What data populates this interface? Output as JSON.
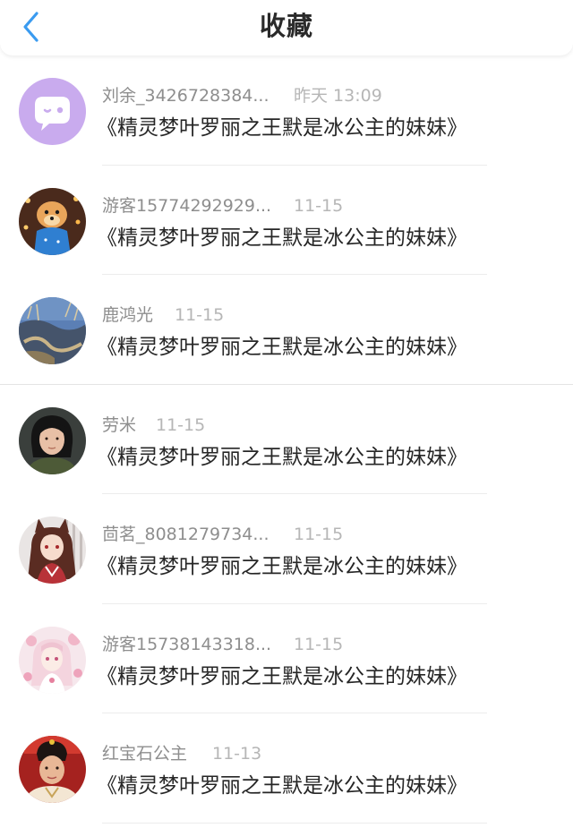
{
  "header": {
    "title": "收藏",
    "back_icon": "chevron-left-icon",
    "accent": "#3a9bf0"
  },
  "items": [
    {
      "user": "刘余_3426728384...",
      "time": "昨天 13:09",
      "title": "《精灵梦叶罗丽之王默是冰公主的妹妹》",
      "avatar": "chat-bubble-avatar"
    },
    {
      "user": "游客15774292929...",
      "time": "11-15",
      "title": "《精灵梦叶罗丽之王默是冰公主的妹妹》",
      "avatar": "puppy-photo-avatar"
    },
    {
      "user": "鹿鸿光",
      "time": "11-15",
      "title": "《精灵梦叶罗丽之王默是冰公主的妹妹》",
      "avatar": "landscape-photo-avatar"
    },
    {
      "user": "劳米",
      "time": "11-15",
      "title": "《精灵梦叶罗丽之王默是冰公主的妹妹》",
      "avatar": "selfie-photo-avatar"
    },
    {
      "user": "茴茗_8081279734...",
      "time": "11-15",
      "title": "《精灵梦叶罗丽之王默是冰公主的妹妹》",
      "avatar": "anime-fox-girl-avatar"
    },
    {
      "user": "游客15738143318...",
      "time": "11-15",
      "title": "《精灵梦叶罗丽之王默是冰公主的妹妹》",
      "avatar": "anime-pink-girl-avatar"
    },
    {
      "user": "红宝石公主",
      "time": "11-13",
      "title": "《精灵梦叶罗丽之王默是冰公主的妹妹》",
      "avatar": "portrait-photo-avatar"
    }
  ]
}
